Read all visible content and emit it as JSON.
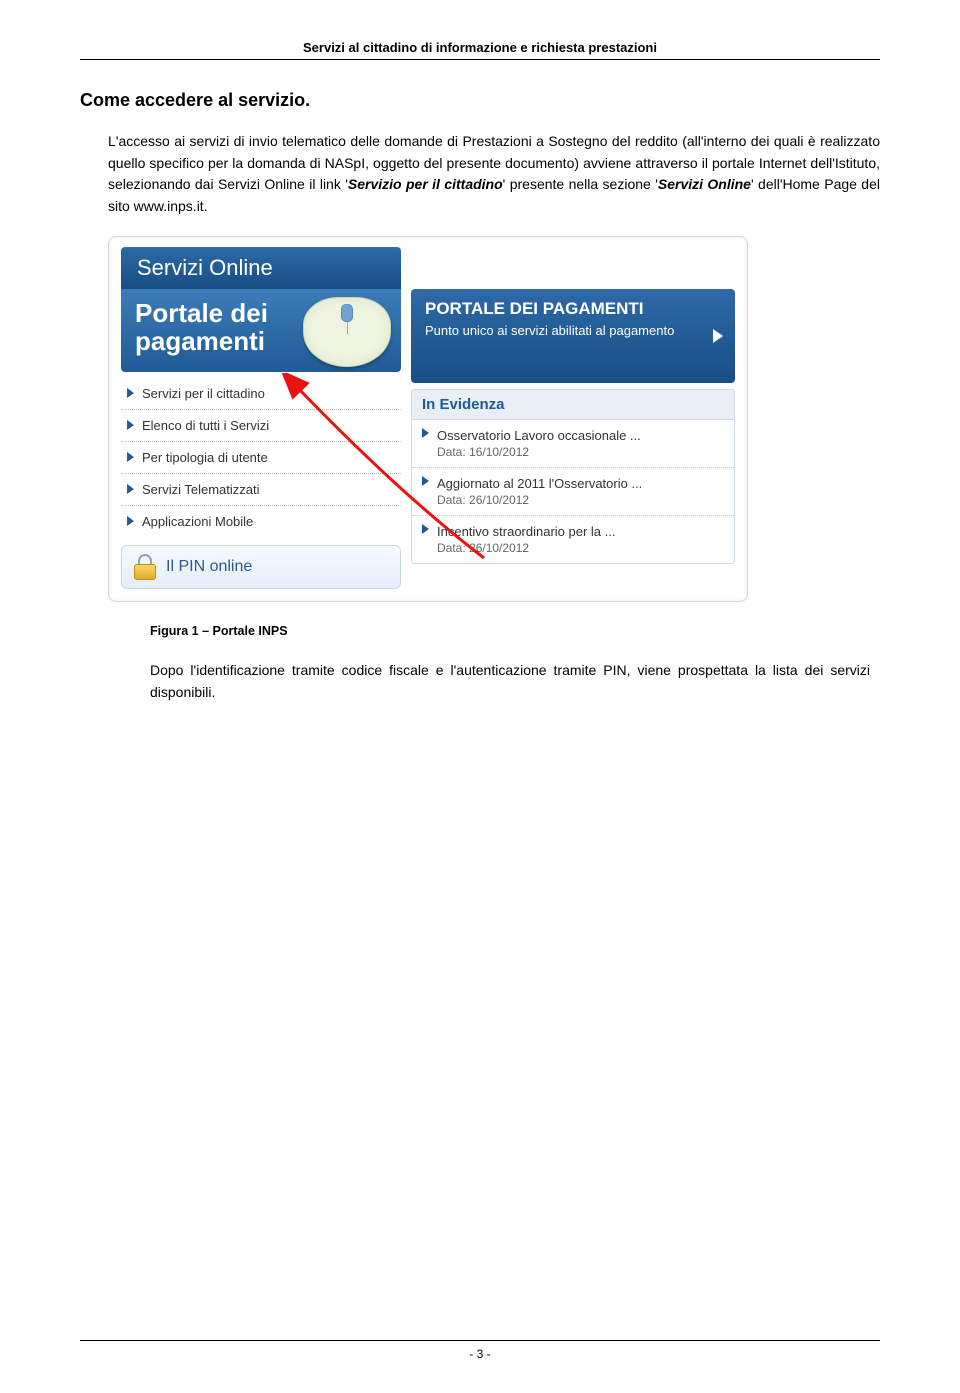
{
  "header": "Servizi al cittadino di informazione e richiesta prestazioni",
  "title": "Come accedere al servizio.",
  "para1_a": "L'accesso ai servizi di invio telematico delle domande di Prestazioni a Sostegno del reddito (all'interno dei quali è realizzato quello specifico per la domanda di NASpI, oggetto del presente documento) avviene attraverso il portale Internet dell'Istituto, selezionando dai Servizi Online il link '",
  "para1_link1": "Servizio per il cittadino",
  "para1_b": "' presente nella sezione '",
  "para1_link2": "Servizi Online",
  "para1_c": "' dell'Home Page del sito www.inps.it.",
  "widget": {
    "tab": "Servizi Online",
    "hero_l1": "Portale dei",
    "hero_l2": "pagamenti",
    "side_items": [
      "Servizi per il cittadino",
      "Elenco di tutti i Servizi",
      "Per tipologia di utente",
      "Servizi Telematizzati",
      "Applicazioni Mobile"
    ],
    "pin": "Il PIN online",
    "promo_title": "PORTALE DEI PAGAMENTI",
    "promo_sub": "Punto unico ai servizi abilitati al pagamento",
    "evidenza": "In Evidenza",
    "ev_items": [
      {
        "t": "Osservatorio Lavoro occasionale ...",
        "d": "Data: 16/10/2012"
      },
      {
        "t": "Aggiornato al 2011 l'Osservatorio ...",
        "d": "Data: 26/10/2012"
      },
      {
        "t": "Incentivo straordinario per la ...",
        "d": "Data: 26/10/2012"
      }
    ]
  },
  "caption": "Figura 1 – Portale INPS",
  "closing": "Dopo l'identificazione tramite codice fiscale e l'autenticazione tramite PIN, viene prospettata la lista dei servizi disponibili.",
  "pagenum": "- 3 -"
}
